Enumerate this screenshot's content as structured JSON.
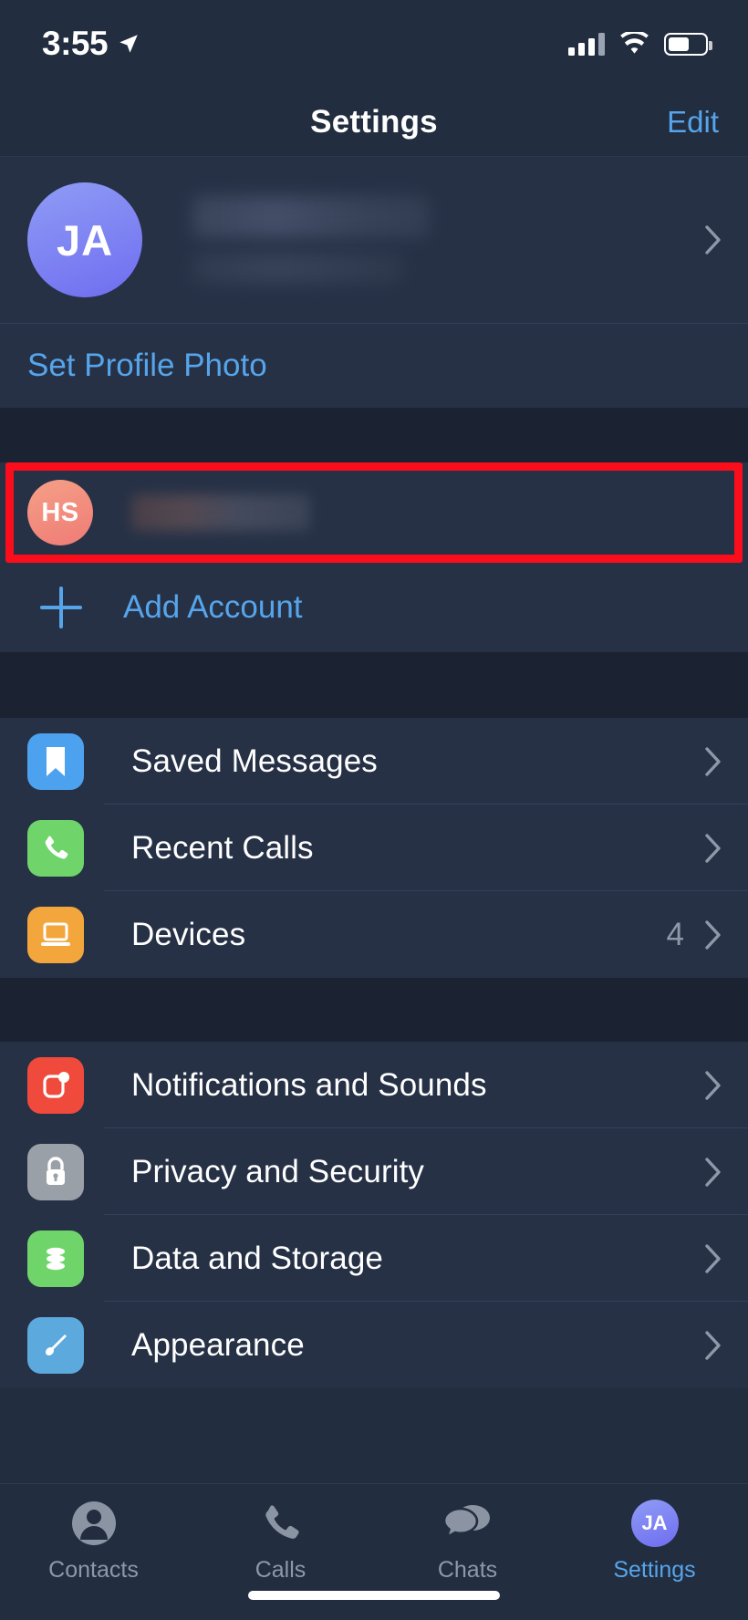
{
  "status_bar": {
    "time": "3:55",
    "location_icon": "location-arrow-icon",
    "cellular_icon": "cellular-bars-icon",
    "wifi_icon": "wifi-icon",
    "battery_icon": "battery-icon"
  },
  "nav": {
    "title": "Settings",
    "edit_label": "Edit",
    "accent": "#56a5eb"
  },
  "profile": {
    "initials": "JA",
    "name_redacted": "",
    "phone_redacted": "",
    "avatar_color": "#6f6df0",
    "set_photo_label": "Set Profile Photo"
  },
  "accounts": {
    "items": [
      {
        "initials": "HS",
        "name_redacted": "",
        "avatar_color": "#ef7b76",
        "highlighted": true
      }
    ],
    "add_label": "Add Account",
    "add_icon": "plus-icon",
    "highlight_color": "#fc0d1b"
  },
  "sections": [
    {
      "items": [
        {
          "label": "Saved Messages",
          "icon": "bookmark-icon",
          "color": "#4da2f0",
          "value": ""
        },
        {
          "label": "Recent Calls",
          "icon": "phone-icon",
          "color": "#6fd56a",
          "value": ""
        },
        {
          "label": "Devices",
          "icon": "laptop-icon",
          "color": "#f3a63c",
          "value": "4"
        }
      ]
    },
    {
      "items": [
        {
          "label": "Notifications and Sounds",
          "icon": "bell-icon",
          "color": "#ef4a3c",
          "value": ""
        },
        {
          "label": "Privacy and Security",
          "icon": "lock-icon",
          "color": "#9aa0a8",
          "value": ""
        },
        {
          "label": "Data and Storage",
          "icon": "database-icon",
          "color": "#6fd56a",
          "value": ""
        },
        {
          "label": "Appearance",
          "icon": "paintbrush-icon",
          "color": "#5ca9dd",
          "value": ""
        }
      ]
    }
  ],
  "tabbar": {
    "tabs": [
      {
        "label": "Contacts",
        "icon": "person-icon",
        "active": false
      },
      {
        "label": "Calls",
        "icon": "phone-icon",
        "active": false
      },
      {
        "label": "Chats",
        "icon": "chat-bubbles-icon",
        "active": false
      },
      {
        "label": "Settings",
        "icon": "avatar-icon",
        "active": true,
        "initials": "JA"
      }
    ]
  }
}
